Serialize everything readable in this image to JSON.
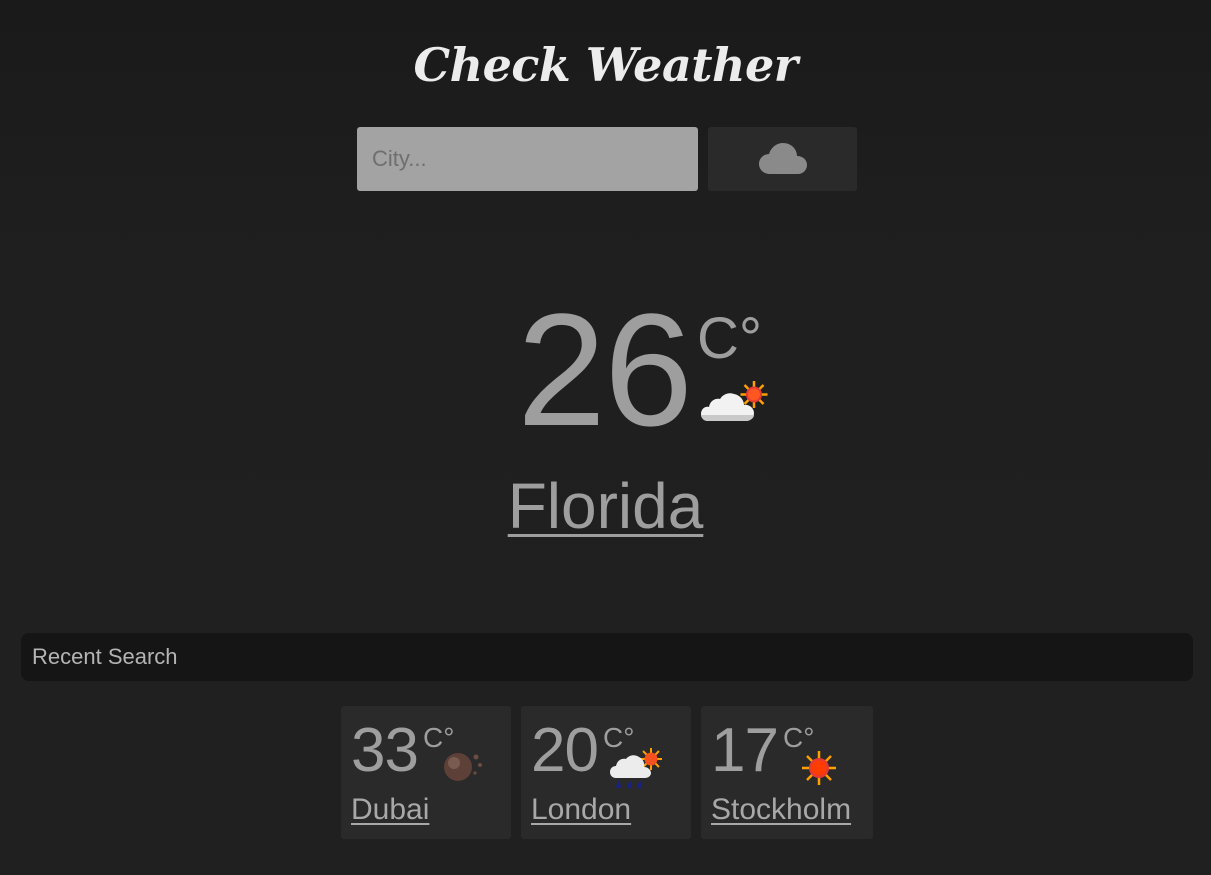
{
  "header": {
    "title": "Check Weather"
  },
  "search": {
    "placeholder": "City...",
    "value": "",
    "button_icon": "cloud-icon"
  },
  "current": {
    "temperature": "26",
    "unit": "C°",
    "condition_icon": "partly-cloudy-icon",
    "city": "Florida"
  },
  "recent": {
    "label": "Recent Search",
    "items": [
      {
        "temperature": "33",
        "unit": "C°",
        "condition_icon": "dust-icon",
        "city": "Dubai"
      },
      {
        "temperature": "20",
        "unit": "C°",
        "condition_icon": "rain-sun-icon",
        "city": "London"
      },
      {
        "temperature": "17",
        "unit": "C°",
        "condition_icon": "sun-icon",
        "city": "Stockholm"
      }
    ]
  },
  "colors": {
    "background": "#1f1f1f",
    "input": "#a3a3a3",
    "button": "#2a2a2a",
    "text": "#9e9e9e",
    "recent_bar": "#151515"
  }
}
